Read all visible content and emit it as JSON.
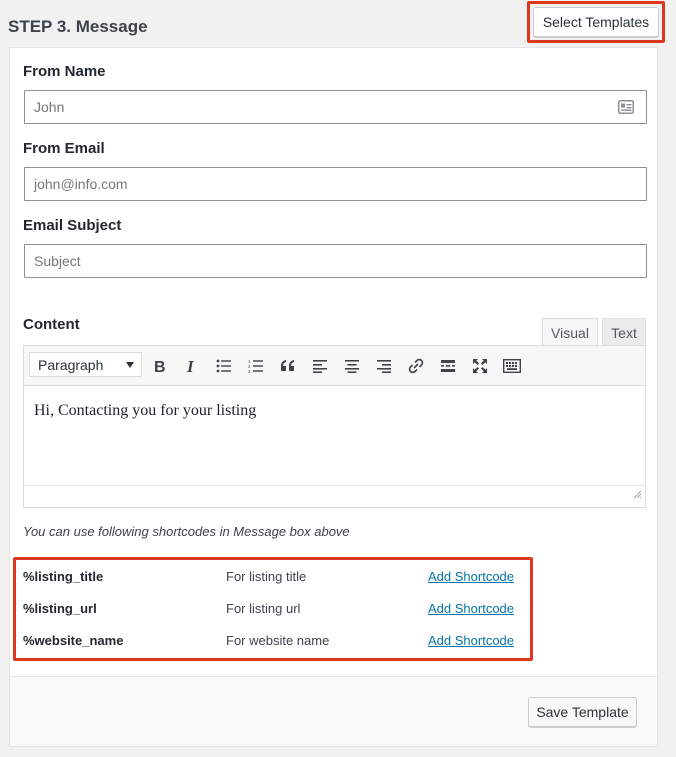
{
  "header": {
    "step_title": "STEP 3. Message",
    "select_templates_label": "Select Templates"
  },
  "fields": {
    "from_name": {
      "label": "From Name",
      "value": "John",
      "icon": "id-card-icon"
    },
    "from_email": {
      "label": "From Email",
      "value": "john@info.com"
    },
    "email_subject": {
      "label": "Email Subject",
      "value": "Subject"
    }
  },
  "content": {
    "label": "Content",
    "tabs": {
      "visual": "Visual",
      "text": "Text"
    },
    "format_select": "Paragraph",
    "toolbar_icons": [
      "bold-icon",
      "italic-icon",
      "bulleted-list-icon",
      "numbered-list-icon",
      "blockquote-icon",
      "align-left-icon",
      "align-center-icon",
      "align-right-icon",
      "link-icon",
      "read-more-icon",
      "fullscreen-icon",
      "toolbar-toggle-icon"
    ],
    "body_text": "Hi, Contacting you for your listing"
  },
  "shortcodes": {
    "hint": "You can use following shortcodes in Message box above",
    "items": [
      {
        "code": "%listing_title",
        "description": "For listing title",
        "action": "Add Shortcode"
      },
      {
        "code": "%listing_url",
        "description": "For listing url",
        "action": "Add Shortcode"
      },
      {
        "code": "%website_name",
        "description": "For website name",
        "action": "Add Shortcode"
      }
    ]
  },
  "footer": {
    "save_label": "Save Template"
  },
  "colors": {
    "highlight": "#e0381f",
    "link": "#0073aa"
  }
}
